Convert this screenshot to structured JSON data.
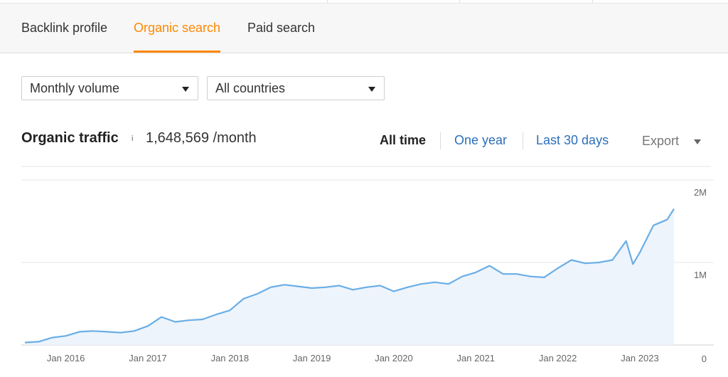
{
  "tabs": [
    {
      "label": "Backlink profile",
      "active": false
    },
    {
      "label": "Organic search",
      "active": true
    },
    {
      "label": "Paid search",
      "active": false
    }
  ],
  "filters": {
    "volume": "Monthly volume",
    "country": "All countries"
  },
  "summary": {
    "title": "Organic traffic",
    "info_icon": "i",
    "value": "1,648,569 /month"
  },
  "ranges": [
    {
      "label": "All time",
      "active": true
    },
    {
      "label": "One year",
      "active": false
    },
    {
      "label": "Last 30 days",
      "active": false
    }
  ],
  "export_label": "Export",
  "colors": {
    "accent": "#ff8800",
    "line": "#6aaee6",
    "area": "#eef4fc",
    "link": "#2b6fba"
  },
  "chart_data": {
    "type": "area",
    "title": "",
    "xlabel": "",
    "ylabel": "",
    "y_tick_labels": [
      "0",
      "1M",
      "2M"
    ],
    "y_ticks": [
      0,
      1000000,
      2000000
    ],
    "ylim": [
      0,
      2000000
    ],
    "xlim": [
      "2015-07",
      "2023-06"
    ],
    "x_tick_labels": [
      "Jan 2016",
      "Jan 2017",
      "Jan 2018",
      "Jan 2019",
      "Jan 2020",
      "Jan 2021",
      "Jan 2022",
      "Jan 2023"
    ],
    "x_ticks": [
      "2016-01",
      "2017-01",
      "2018-01",
      "2019-01",
      "2020-01",
      "2021-01",
      "2022-01",
      "2023-01"
    ],
    "grid": true,
    "points": [
      [
        "2015-07",
        30000
      ],
      [
        "2015-09",
        40000
      ],
      [
        "2015-11",
        90000
      ],
      [
        "2016-01",
        110000
      ],
      [
        "2016-03",
        160000
      ],
      [
        "2016-05",
        170000
      ],
      [
        "2016-07",
        160000
      ],
      [
        "2016-09",
        150000
      ],
      [
        "2016-11",
        170000
      ],
      [
        "2017-01",
        230000
      ],
      [
        "2017-03",
        340000
      ],
      [
        "2017-05",
        280000
      ],
      [
        "2017-07",
        300000
      ],
      [
        "2017-09",
        310000
      ],
      [
        "2017-11",
        370000
      ],
      [
        "2018-01",
        420000
      ],
      [
        "2018-03",
        560000
      ],
      [
        "2018-05",
        620000
      ],
      [
        "2018-07",
        700000
      ],
      [
        "2018-09",
        730000
      ],
      [
        "2018-11",
        710000
      ],
      [
        "2019-01",
        690000
      ],
      [
        "2019-03",
        700000
      ],
      [
        "2019-05",
        720000
      ],
      [
        "2019-07",
        670000
      ],
      [
        "2019-09",
        700000
      ],
      [
        "2019-11",
        720000
      ],
      [
        "2020-01",
        650000
      ],
      [
        "2020-03",
        700000
      ],
      [
        "2020-05",
        740000
      ],
      [
        "2020-07",
        760000
      ],
      [
        "2020-09",
        740000
      ],
      [
        "2020-11",
        830000
      ],
      [
        "2021-01",
        880000
      ],
      [
        "2021-03",
        960000
      ],
      [
        "2021-05",
        860000
      ],
      [
        "2021-07",
        860000
      ],
      [
        "2021-09",
        830000
      ],
      [
        "2021-11",
        820000
      ],
      [
        "2022-01",
        930000
      ],
      [
        "2022-03",
        1030000
      ],
      [
        "2022-05",
        990000
      ],
      [
        "2022-07",
        1000000
      ],
      [
        "2022-09",
        1030000
      ],
      [
        "2022-11",
        1260000
      ],
      [
        "2022-12",
        980000
      ],
      [
        "2023-01",
        1120000
      ],
      [
        "2023-03",
        1450000
      ],
      [
        "2023-05",
        1520000
      ],
      [
        "2023-06",
        1650000
      ]
    ]
  }
}
